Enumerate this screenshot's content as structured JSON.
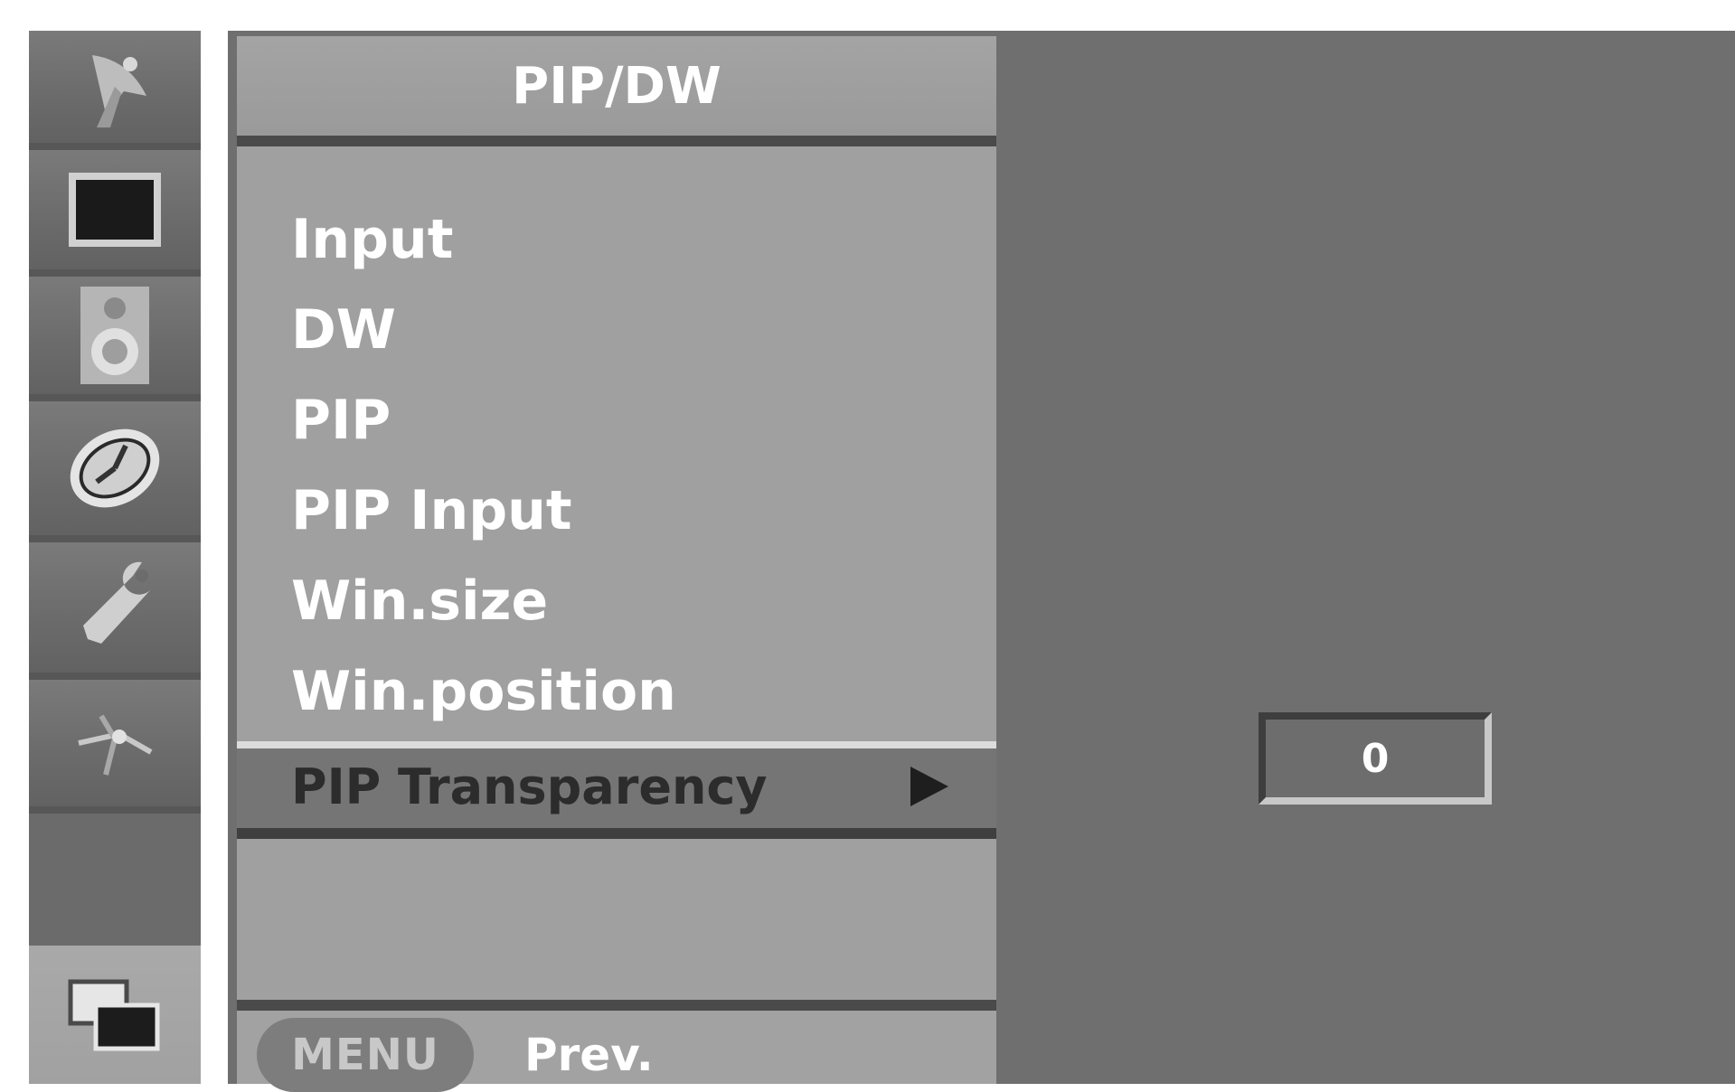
{
  "sidebar": {
    "items": [
      {
        "icon": "satellite-dish-icon",
        "active": false
      },
      {
        "icon": "picture-screen-icon",
        "active": false
      },
      {
        "icon": "speaker-icon",
        "active": false
      },
      {
        "icon": "clock-icon",
        "active": false
      },
      {
        "icon": "wrench-icon",
        "active": false
      },
      {
        "icon": "input-source-icon",
        "active": false
      },
      {
        "icon": "pip-windows-icon",
        "active": true
      }
    ]
  },
  "menu": {
    "title": "PIP/DW",
    "items": [
      {
        "label": "Input"
      },
      {
        "label": "DW"
      },
      {
        "label": "PIP"
      },
      {
        "label": "PIP Input"
      },
      {
        "label": "Win.size"
      },
      {
        "label": "Win.position"
      }
    ],
    "selected": {
      "label": "PIP Transparency",
      "arrow": "right-arrow-icon"
    },
    "footer": {
      "key": "MENU",
      "action": "Prev."
    }
  },
  "value": {
    "display": "0"
  },
  "colors": {
    "panel_bg": "#6f6f6f",
    "menu_bg": "#a0a0a0",
    "selected_bg": "#757575",
    "text": "#ffffff"
  }
}
